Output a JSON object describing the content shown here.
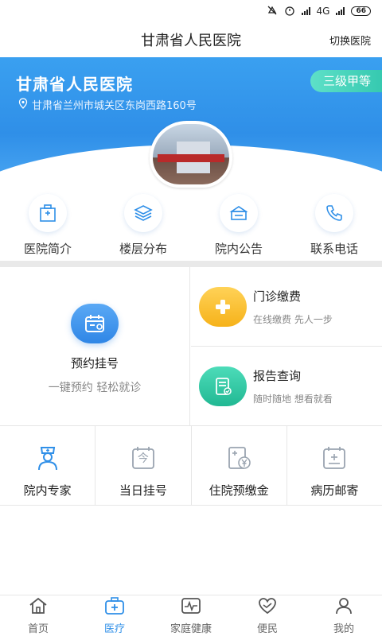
{
  "status": {
    "network": "4G",
    "battery": "66"
  },
  "header": {
    "title": "甘肃省人民医院",
    "switch_label": "切换医院"
  },
  "hero": {
    "name": "甘肃省人民医院",
    "address": "甘肃省兰州市城关区东岗西路160号",
    "level_badge": "三级甲等"
  },
  "quick": {
    "items": [
      {
        "label": "医院简介",
        "icon": "hospital-icon"
      },
      {
        "label": "楼层分布",
        "icon": "layers-icon"
      },
      {
        "label": "院内公告",
        "icon": "notice-icon"
      },
      {
        "label": "联系电话",
        "icon": "phone-icon"
      }
    ]
  },
  "services": {
    "appointment": {
      "title": "预约挂号",
      "subtitle": "一键预约 轻松就诊",
      "icon": "calendar-icon"
    },
    "payment": {
      "title": "门诊缴费",
      "subtitle": "在线缴费 先人一步",
      "icon": "plus-icon"
    },
    "report": {
      "title": "报告查询",
      "subtitle": "随时随地 想看就看",
      "icon": "report-icon"
    },
    "grid": [
      {
        "label": "院内专家",
        "icon": "doctor-icon"
      },
      {
        "label": "当日挂号",
        "icon": "today-icon",
        "glyph": "今"
      },
      {
        "label": "住院预缴金",
        "icon": "deposit-icon"
      },
      {
        "label": "病历邮寄",
        "icon": "record-icon"
      }
    ]
  },
  "tabbar": {
    "items": [
      {
        "label": "首页",
        "icon": "home-icon"
      },
      {
        "label": "医疗",
        "icon": "medical-kit-icon"
      },
      {
        "label": "家庭健康",
        "icon": "heartbeat-icon"
      },
      {
        "label": "便民",
        "icon": "heart-hand-icon"
      },
      {
        "label": "我的",
        "icon": "user-icon"
      }
    ]
  },
  "colors": {
    "primary": "#2f8fe8",
    "badge": "#36c9b0",
    "payment": "#f6b21a",
    "report": "#2fc7a6",
    "tab_active": "#2f8fe8"
  }
}
